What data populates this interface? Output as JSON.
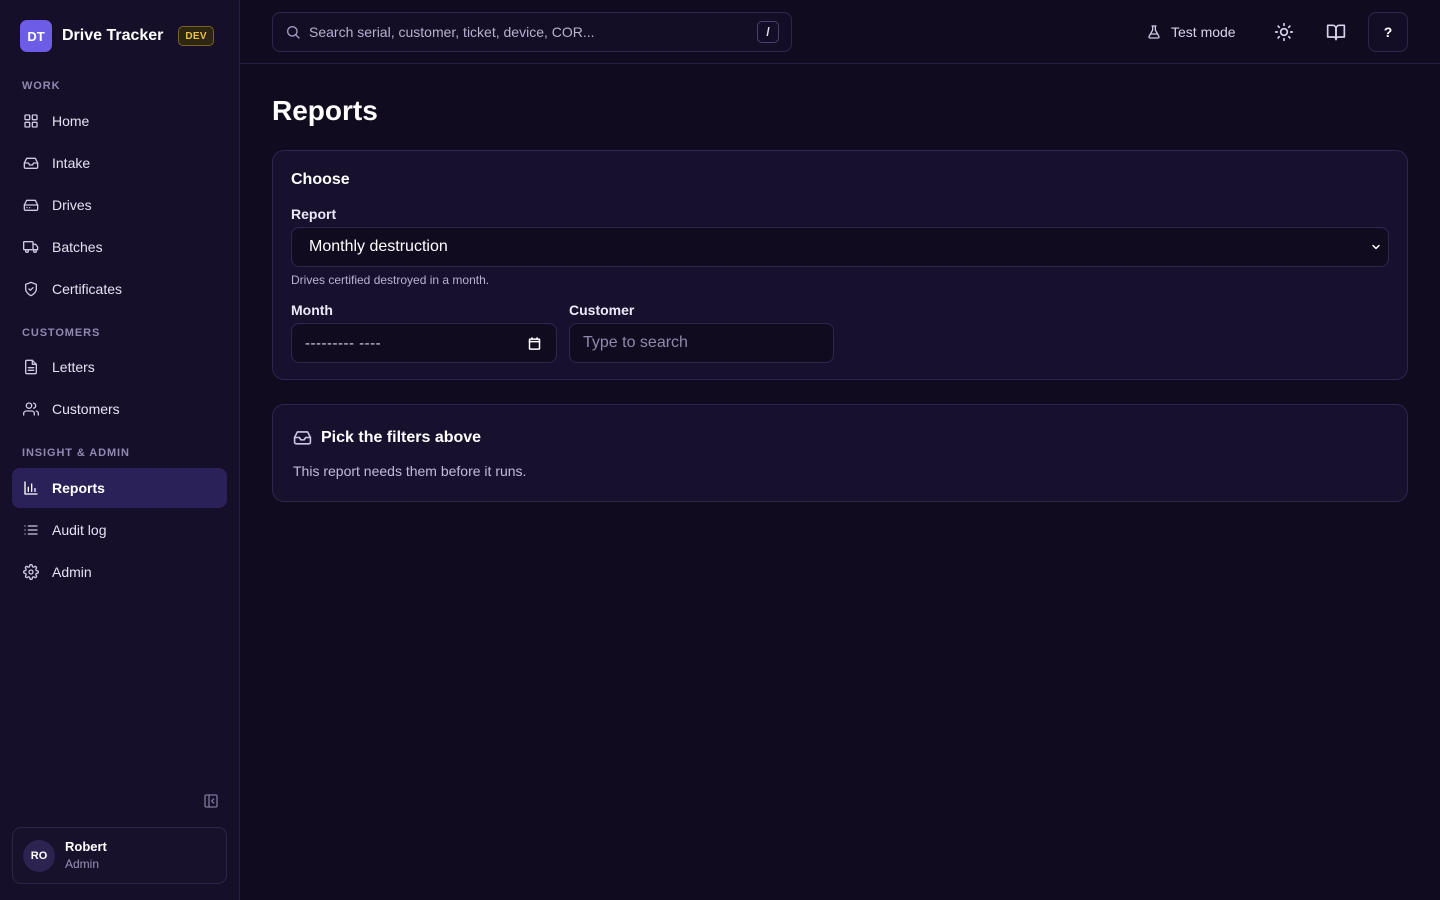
{
  "brand": {
    "logo_initials": "DT",
    "name": "Drive Tracker",
    "env_badge": "DEV"
  },
  "nav": {
    "sections": [
      {
        "heading": "WORK",
        "items": [
          {
            "label": "Home",
            "icon": "grid-icon"
          },
          {
            "label": "Intake",
            "icon": "inbox-icon"
          },
          {
            "label": "Drives",
            "icon": "hard-drive-icon"
          },
          {
            "label": "Batches",
            "icon": "truck-icon"
          },
          {
            "label": "Certificates",
            "icon": "shield-check-icon"
          }
        ]
      },
      {
        "heading": "CUSTOMERS",
        "items": [
          {
            "label": "Letters",
            "icon": "file-text-icon"
          },
          {
            "label": "Customers",
            "icon": "users-icon"
          }
        ]
      },
      {
        "heading": "INSIGHT & ADMIN",
        "items": [
          {
            "label": "Reports",
            "icon": "bar-chart-icon",
            "active": true
          },
          {
            "label": "Audit log",
            "icon": "list-icon"
          },
          {
            "label": "Admin",
            "icon": "gear-icon"
          }
        ]
      }
    ]
  },
  "user": {
    "initials": "RO",
    "name": "Robert",
    "role": "Admin"
  },
  "topbar": {
    "search_placeholder": "Search serial, customer, ticket, device, COR...",
    "search_shortcut": "/",
    "test_mode_label": "Test mode",
    "help_label": "?"
  },
  "page": {
    "title": "Reports"
  },
  "choose_card": {
    "heading": "Choose",
    "report_label": "Report",
    "report_selected": "Monthly destruction",
    "report_hint": "Drives certified destroyed in a month.",
    "month_label": "Month",
    "month_value": "--------- ----",
    "customer_label": "Customer",
    "customer_placeholder": "Type to search"
  },
  "empty_state": {
    "title": "Pick the filters above",
    "description": "This report needs them before it runs."
  },
  "colors": {
    "background": "#100b1f",
    "sidebar": "#150f29",
    "accent": "#6d5ce6",
    "active_nav": "#2b2159",
    "dev_badge": "#f0c24b"
  }
}
